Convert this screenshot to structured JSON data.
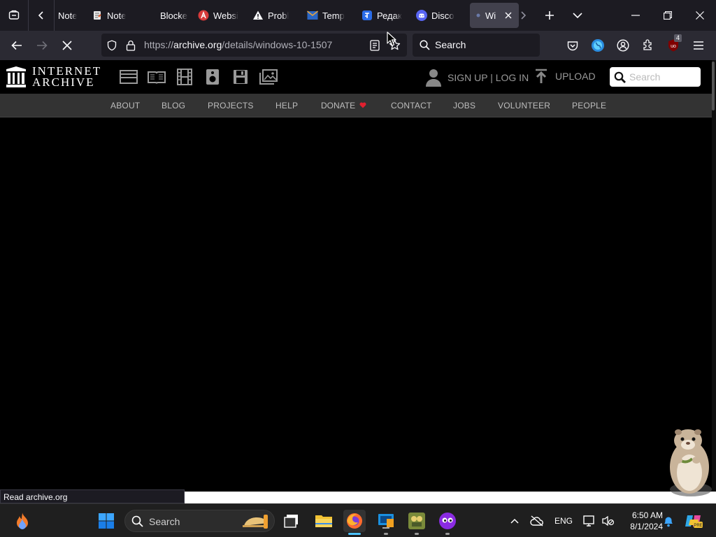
{
  "browser": {
    "tabs": [
      {
        "title": "Note",
        "favicon": "note-favicon"
      },
      {
        "title": "Note",
        "favicon": "note-favicon"
      },
      {
        "title": "Blocked b",
        "favicon": "blocked-favicon"
      },
      {
        "title": "Websi",
        "favicon": "website-favicon"
      },
      {
        "title": "Probl",
        "favicon": "warning-favicon"
      },
      {
        "title": "Temp",
        "favicon": "mail-favicon"
      },
      {
        "title": "Редак",
        "favicon": "editor-favicon"
      },
      {
        "title": "Disco",
        "favicon": "discord-favicon"
      },
      {
        "title": "Wi",
        "favicon": "loading-favicon",
        "active": true
      }
    ],
    "url": {
      "scheme": "https://",
      "host": "archive.org",
      "path": "/details/windows-10-1507"
    },
    "search_placeholder": "Search",
    "extension_badge": "4",
    "status_text": "Read archive.org"
  },
  "ia": {
    "logo_line1": "INTERNET",
    "logo_line2": "ARCHIVE",
    "signup": "SIGN UP | LOG IN",
    "upload": "UPLOAD",
    "search_placeholder": "Search",
    "nav": [
      "ABOUT",
      "BLOG",
      "PROJECTS",
      "HELP",
      "DONATE",
      "CONTACT",
      "JOBS",
      "VOLUNTEER",
      "PEOPLE"
    ]
  },
  "taskbar": {
    "search_placeholder": "Search",
    "language": "ENG",
    "time": "6:50 AM",
    "date": "8/1/2024"
  },
  "colors": {
    "accent": "#4cc2ff",
    "donate_heart": "#e0202f"
  }
}
